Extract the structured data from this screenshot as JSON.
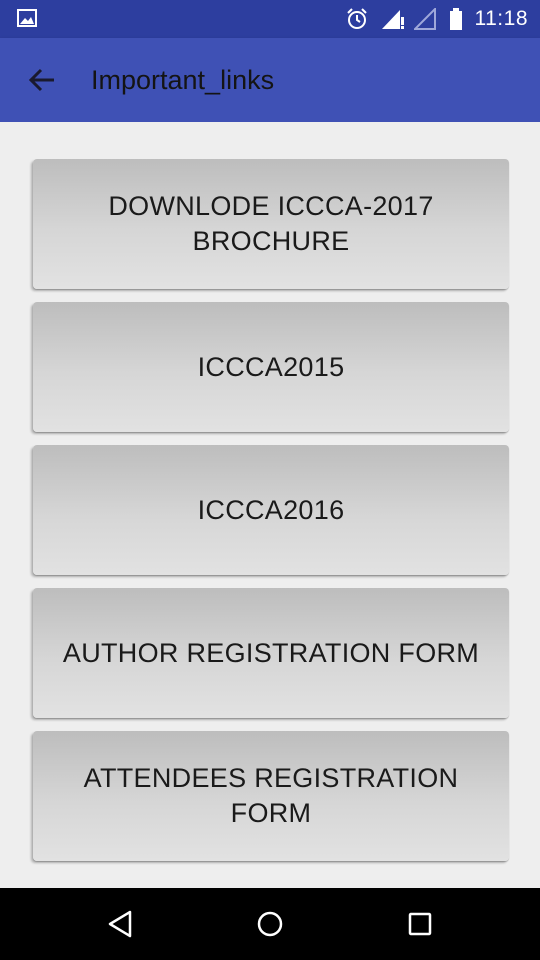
{
  "status_bar": {
    "time": "11:18",
    "icons": [
      "image-icon",
      "alarm-icon",
      "signal-icon",
      "signal-empty-icon",
      "battery-icon"
    ]
  },
  "app_bar": {
    "title": "Important_links",
    "back_icon": "arrow-left-icon"
  },
  "links": [
    {
      "label": "DOWNLODE ICCCA-2017 BROCHURE"
    },
    {
      "label": "ICCCA2015"
    },
    {
      "label": "ICCCA2016"
    },
    {
      "label": "AUTHOR REGISTRATION FORM"
    },
    {
      "label": "ATTENDEES REGISTRATION FORM"
    }
  ],
  "nav_bar": {
    "icons": [
      "back-triangle-icon",
      "home-circle-icon",
      "recents-square-icon"
    ]
  },
  "colors": {
    "status_bar": "#2d3e9f",
    "app_bar": "#3f51b5",
    "background": "#eeeeee",
    "button": "#d6d6d6"
  }
}
